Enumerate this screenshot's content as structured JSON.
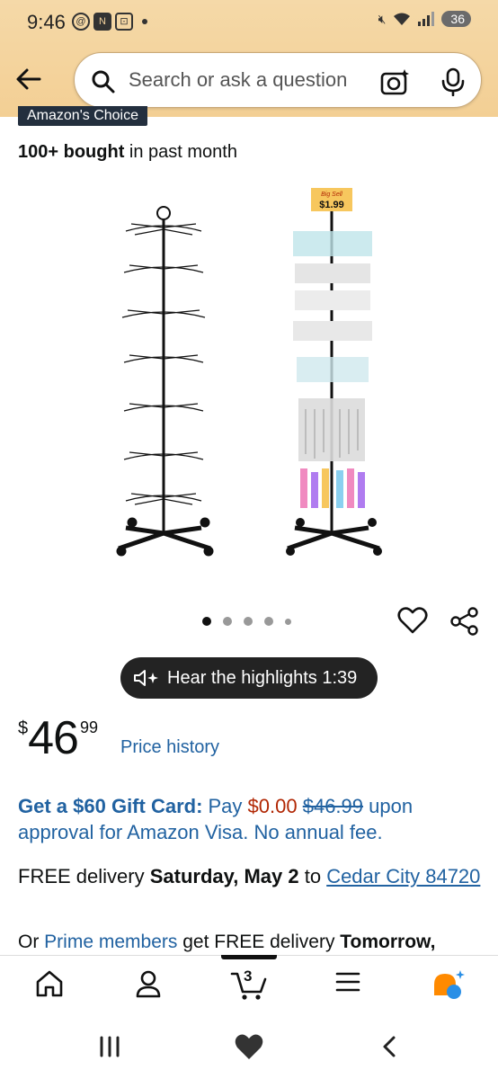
{
  "status_bar": {
    "time": "9:46",
    "battery": "36"
  },
  "search": {
    "placeholder": "Search or ask a question"
  },
  "product": {
    "badge": "Amazon's Choice",
    "bought_bold": "100+ bought",
    "bought_rest": " in past month",
    "image_label": "$1.99",
    "image_caption": "Big Sell",
    "image_count": 5,
    "active_image": 1
  },
  "audio": {
    "label": "Hear the highlights 1:39"
  },
  "price": {
    "currency": "$",
    "whole": "46",
    "fraction": "99",
    "history_link": "Price history"
  },
  "promo": {
    "bold": "Get a $60 Gift Card:",
    "pay": " Pay ",
    "amount": "$0.00",
    "old": "$46.99",
    "rest": " upon approval for Amazon Visa. No annual fee."
  },
  "delivery": {
    "prefix": "FREE delivery ",
    "date": "Saturday, May 2",
    "to": " to ",
    "location": "Cedar City 84720"
  },
  "prime": {
    "prefix": "Or ",
    "link": "Prime members",
    "middle": " get FREE delivery ",
    "date": "Tomorrow,"
  },
  "bottom_nav": {
    "cart_count": "3"
  },
  "colors": {
    "header": "#f3cf94",
    "link": "#2162a1",
    "price_red": "#b12704",
    "badge": "#232f3e"
  }
}
